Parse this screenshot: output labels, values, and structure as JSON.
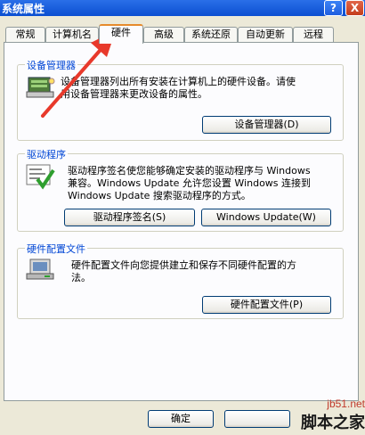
{
  "window": {
    "title": "系统属性",
    "help_label": "?",
    "close_label": "X"
  },
  "tabs": [
    {
      "label": "常规"
    },
    {
      "label": "计算机名"
    },
    {
      "label": "硬件"
    },
    {
      "label": "高级"
    },
    {
      "label": "系统还原"
    },
    {
      "label": "自动更新"
    },
    {
      "label": "远程"
    }
  ],
  "device_manager": {
    "title": "设备管理器",
    "desc_line1": "设备管理器列出所有安装在计算机上的硬件设备。请使",
    "desc_line2": "用设备管理器来更改设备的属性。",
    "button_label": "设备管理器(D)"
  },
  "drivers": {
    "title": "驱动程序",
    "desc_line1": "驱动程序签名使您能够确定安装的驱动程序与 Windows",
    "desc_line2": "兼容。Windows Update 允许您设置 Windows 连接到",
    "desc_line3": "Windows Update 搜索驱动程序的方式。",
    "signing_button_label": "驱动程序签名(S)",
    "update_button_label": "Windows Update(W)"
  },
  "hardware_profiles": {
    "title": "硬件配置文件",
    "desc_line1": "硬件配置文件向您提供建立和保存不同硬件配置的方",
    "desc_line2": "法。",
    "button_label": "硬件配置文件(P)"
  },
  "footer": {
    "ok_label": "确定"
  },
  "watermark": {
    "site": "jb51.net",
    "name": "脚本之家"
  },
  "colors": {
    "titlebar": "#0b4fd1",
    "group_title": "#0046d5",
    "annotation_arrow": "#e8392b",
    "active_tab_accent": "#e68b2c"
  }
}
